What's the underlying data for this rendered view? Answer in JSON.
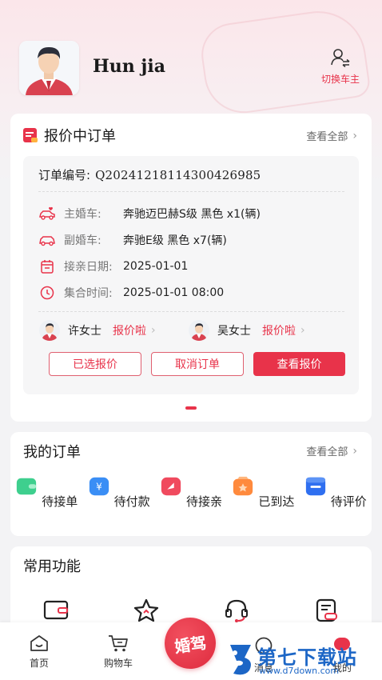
{
  "header": {
    "user_name": "Hun jia",
    "switch_label": "切换车主"
  },
  "quote_orders": {
    "title": "报价中订单",
    "view_all": "查看全部",
    "order_no_label": "订单编号:",
    "order_no": "Q20241218114300426985",
    "rows": [
      {
        "label": "主婚车:",
        "value": "奔驰迈巴赫S级 黑色 x1(辆)",
        "icon": "wedding-car-icon"
      },
      {
        "label": "副婚车:",
        "value": "奔驰E级 黑色 x7(辆)",
        "icon": "car-icon"
      },
      {
        "label": "接亲日期:",
        "value": "2025-01-01",
        "icon": "calendar-icon"
      },
      {
        "label": "集合时间:",
        "value": "2025-01-01 08:00",
        "icon": "clock-icon"
      }
    ],
    "quoters": [
      {
        "name": "许女士",
        "status": "报价啦"
      },
      {
        "name": "吴女士",
        "status": "报价啦"
      }
    ],
    "buttons": {
      "selected_quote": "已选报价",
      "cancel_order": "取消订单",
      "view_quote": "查看报价"
    }
  },
  "my_orders": {
    "title": "我的订单",
    "view_all": "查看全部",
    "items": [
      {
        "label": "待接单",
        "color": "#3ecf8e"
      },
      {
        "label": "待付款",
        "color": "#3a8ef5"
      },
      {
        "label": "待接亲",
        "color": "#f04a5e"
      },
      {
        "label": "已到达",
        "color": "#ff8a3d"
      },
      {
        "label": "待评价",
        "color": "#2f6ff0"
      }
    ]
  },
  "common_functions": {
    "title": "常用功能",
    "icons": [
      "wallet-icon",
      "star-icon",
      "headset-icon",
      "document-icon"
    ]
  },
  "tabbar": {
    "home": "首页",
    "cart": "购物车",
    "center": "婚驾",
    "messages": "消息",
    "mine": "我的"
  },
  "watermark": {
    "text": "第七下载站",
    "url": "www.d7down.com"
  },
  "colors": {
    "accent": "#e8334a"
  }
}
